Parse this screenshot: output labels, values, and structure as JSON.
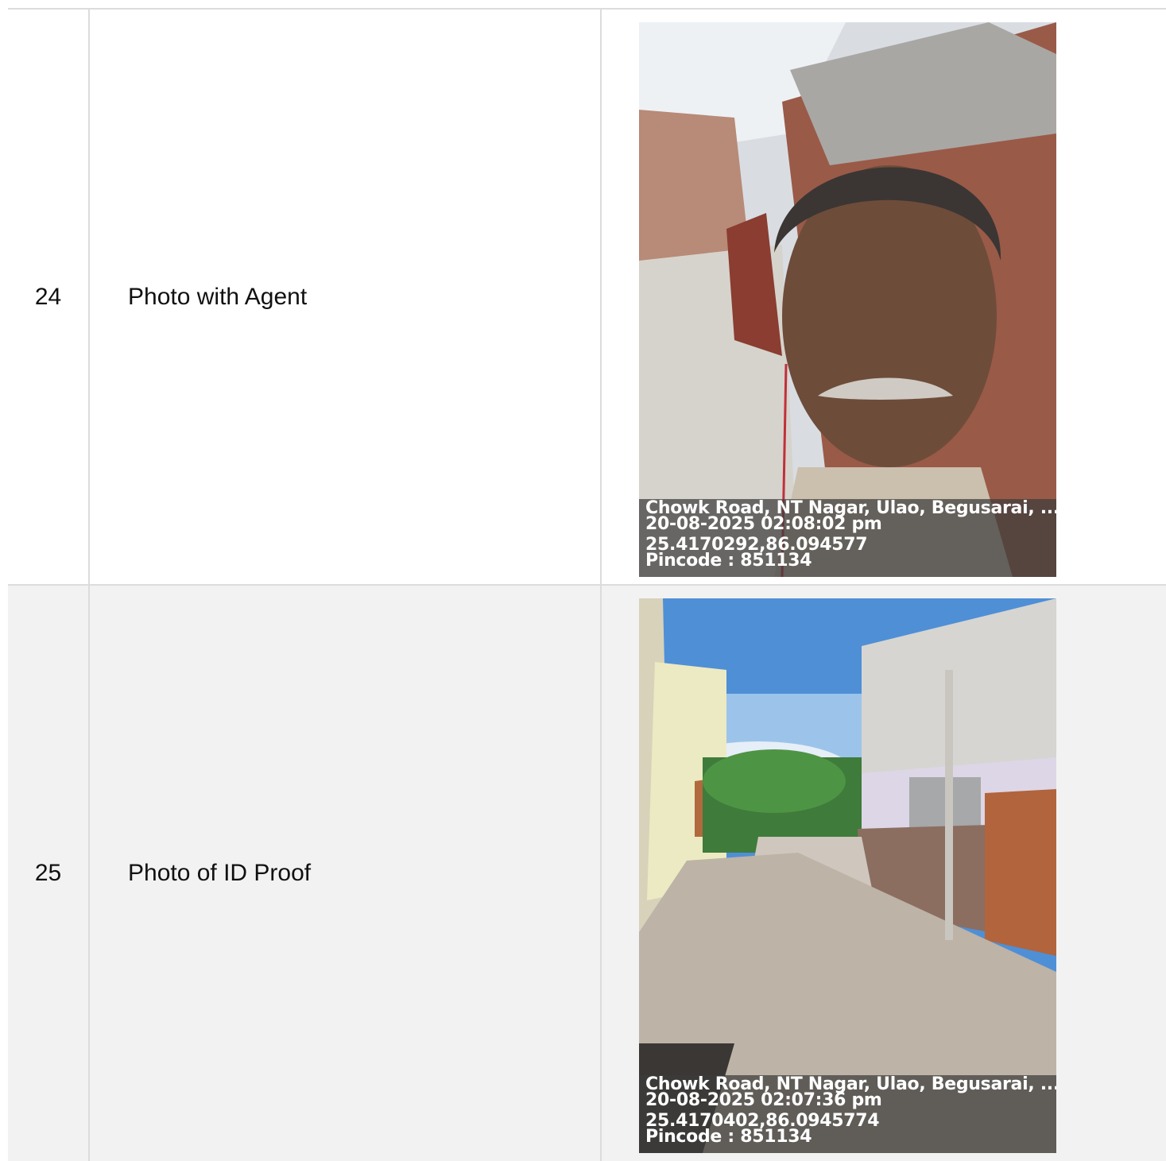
{
  "rows": [
    {
      "number": "24",
      "label": "Photo with Agent",
      "photo": {
        "subject": "selfie",
        "address": "Chowk Road, NT Nagar, Ulao, Begusarai, ...",
        "datetime": "20-08-2025 02:08:02 pm",
        "coords": "25.4170292,86.094577",
        "pincode": "Pincode : 851134"
      }
    },
    {
      "number": "25",
      "label": "Photo of ID Proof",
      "photo": {
        "subject": "street",
        "address": "Chowk Road, NT Nagar, Ulao, Begusarai, ...",
        "datetime": "20-08-2025 02:07:36 pm",
        "coords": "25.4170402,86.0945774",
        "pincode": "Pincode : 851134"
      }
    }
  ]
}
